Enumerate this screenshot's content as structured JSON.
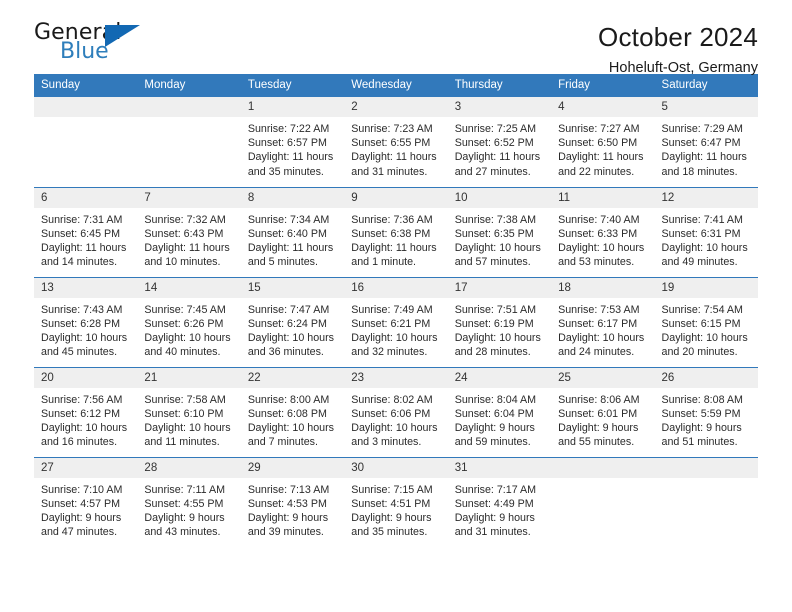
{
  "brand": {
    "name_top": "General",
    "name_bottom": "Blue",
    "accent_color": "#2e7ebb",
    "triangle_color": "#1268b3"
  },
  "header": {
    "title": "October 2024",
    "subtitle": "Hoheluft-Ost, Germany"
  },
  "theme": {
    "header_row_bg": "#3279bb",
    "header_row_text": "#ffffff",
    "daynum_bg": "#efefef",
    "grid_line": "#3279bb"
  },
  "weekdays": [
    "Sunday",
    "Monday",
    "Tuesday",
    "Wednesday",
    "Thursday",
    "Friday",
    "Saturday"
  ],
  "weeks": [
    [
      {
        "day": "",
        "sunrise": "",
        "sunset": "",
        "daylight": "",
        "empty": true
      },
      {
        "day": "",
        "sunrise": "",
        "sunset": "",
        "daylight": "",
        "empty": true
      },
      {
        "day": "1",
        "sunrise": "Sunrise: 7:22 AM",
        "sunset": "Sunset: 6:57 PM",
        "daylight": "Daylight: 11 hours and 35 minutes."
      },
      {
        "day": "2",
        "sunrise": "Sunrise: 7:23 AM",
        "sunset": "Sunset: 6:55 PM",
        "daylight": "Daylight: 11 hours and 31 minutes."
      },
      {
        "day": "3",
        "sunrise": "Sunrise: 7:25 AM",
        "sunset": "Sunset: 6:52 PM",
        "daylight": "Daylight: 11 hours and 27 minutes."
      },
      {
        "day": "4",
        "sunrise": "Sunrise: 7:27 AM",
        "sunset": "Sunset: 6:50 PM",
        "daylight": "Daylight: 11 hours and 22 minutes."
      },
      {
        "day": "5",
        "sunrise": "Sunrise: 7:29 AM",
        "sunset": "Sunset: 6:47 PM",
        "daylight": "Daylight: 11 hours and 18 minutes."
      }
    ],
    [
      {
        "day": "6",
        "sunrise": "Sunrise: 7:31 AM",
        "sunset": "Sunset: 6:45 PM",
        "daylight": "Daylight: 11 hours and 14 minutes."
      },
      {
        "day": "7",
        "sunrise": "Sunrise: 7:32 AM",
        "sunset": "Sunset: 6:43 PM",
        "daylight": "Daylight: 11 hours and 10 minutes."
      },
      {
        "day": "8",
        "sunrise": "Sunrise: 7:34 AM",
        "sunset": "Sunset: 6:40 PM",
        "daylight": "Daylight: 11 hours and 5 minutes."
      },
      {
        "day": "9",
        "sunrise": "Sunrise: 7:36 AM",
        "sunset": "Sunset: 6:38 PM",
        "daylight": "Daylight: 11 hours and 1 minute."
      },
      {
        "day": "10",
        "sunrise": "Sunrise: 7:38 AM",
        "sunset": "Sunset: 6:35 PM",
        "daylight": "Daylight: 10 hours and 57 minutes."
      },
      {
        "day": "11",
        "sunrise": "Sunrise: 7:40 AM",
        "sunset": "Sunset: 6:33 PM",
        "daylight": "Daylight: 10 hours and 53 minutes."
      },
      {
        "day": "12",
        "sunrise": "Sunrise: 7:41 AM",
        "sunset": "Sunset: 6:31 PM",
        "daylight": "Daylight: 10 hours and 49 minutes."
      }
    ],
    [
      {
        "day": "13",
        "sunrise": "Sunrise: 7:43 AM",
        "sunset": "Sunset: 6:28 PM",
        "daylight": "Daylight: 10 hours and 45 minutes."
      },
      {
        "day": "14",
        "sunrise": "Sunrise: 7:45 AM",
        "sunset": "Sunset: 6:26 PM",
        "daylight": "Daylight: 10 hours and 40 minutes."
      },
      {
        "day": "15",
        "sunrise": "Sunrise: 7:47 AM",
        "sunset": "Sunset: 6:24 PM",
        "daylight": "Daylight: 10 hours and 36 minutes."
      },
      {
        "day": "16",
        "sunrise": "Sunrise: 7:49 AM",
        "sunset": "Sunset: 6:21 PM",
        "daylight": "Daylight: 10 hours and 32 minutes."
      },
      {
        "day": "17",
        "sunrise": "Sunrise: 7:51 AM",
        "sunset": "Sunset: 6:19 PM",
        "daylight": "Daylight: 10 hours and 28 minutes."
      },
      {
        "day": "18",
        "sunrise": "Sunrise: 7:53 AM",
        "sunset": "Sunset: 6:17 PM",
        "daylight": "Daylight: 10 hours and 24 minutes."
      },
      {
        "day": "19",
        "sunrise": "Sunrise: 7:54 AM",
        "sunset": "Sunset: 6:15 PM",
        "daylight": "Daylight: 10 hours and 20 minutes."
      }
    ],
    [
      {
        "day": "20",
        "sunrise": "Sunrise: 7:56 AM",
        "sunset": "Sunset: 6:12 PM",
        "daylight": "Daylight: 10 hours and 16 minutes."
      },
      {
        "day": "21",
        "sunrise": "Sunrise: 7:58 AM",
        "sunset": "Sunset: 6:10 PM",
        "daylight": "Daylight: 10 hours and 11 minutes."
      },
      {
        "day": "22",
        "sunrise": "Sunrise: 8:00 AM",
        "sunset": "Sunset: 6:08 PM",
        "daylight": "Daylight: 10 hours and 7 minutes."
      },
      {
        "day": "23",
        "sunrise": "Sunrise: 8:02 AM",
        "sunset": "Sunset: 6:06 PM",
        "daylight": "Daylight: 10 hours and 3 minutes."
      },
      {
        "day": "24",
        "sunrise": "Sunrise: 8:04 AM",
        "sunset": "Sunset: 6:04 PM",
        "daylight": "Daylight: 9 hours and 59 minutes."
      },
      {
        "day": "25",
        "sunrise": "Sunrise: 8:06 AM",
        "sunset": "Sunset: 6:01 PM",
        "daylight": "Daylight: 9 hours and 55 minutes."
      },
      {
        "day": "26",
        "sunrise": "Sunrise: 8:08 AM",
        "sunset": "Sunset: 5:59 PM",
        "daylight": "Daylight: 9 hours and 51 minutes."
      }
    ],
    [
      {
        "day": "27",
        "sunrise": "Sunrise: 7:10 AM",
        "sunset": "Sunset: 4:57 PM",
        "daylight": "Daylight: 9 hours and 47 minutes."
      },
      {
        "day": "28",
        "sunrise": "Sunrise: 7:11 AM",
        "sunset": "Sunset: 4:55 PM",
        "daylight": "Daylight: 9 hours and 43 minutes."
      },
      {
        "day": "29",
        "sunrise": "Sunrise: 7:13 AM",
        "sunset": "Sunset: 4:53 PM",
        "daylight": "Daylight: 9 hours and 39 minutes."
      },
      {
        "day": "30",
        "sunrise": "Sunrise: 7:15 AM",
        "sunset": "Sunset: 4:51 PM",
        "daylight": "Daylight: 9 hours and 35 minutes."
      },
      {
        "day": "31",
        "sunrise": "Sunrise: 7:17 AM",
        "sunset": "Sunset: 4:49 PM",
        "daylight": "Daylight: 9 hours and 31 minutes."
      },
      {
        "day": "",
        "sunrise": "",
        "sunset": "",
        "daylight": "",
        "empty": true
      },
      {
        "day": "",
        "sunrise": "",
        "sunset": "",
        "daylight": "",
        "empty": true
      }
    ]
  ]
}
